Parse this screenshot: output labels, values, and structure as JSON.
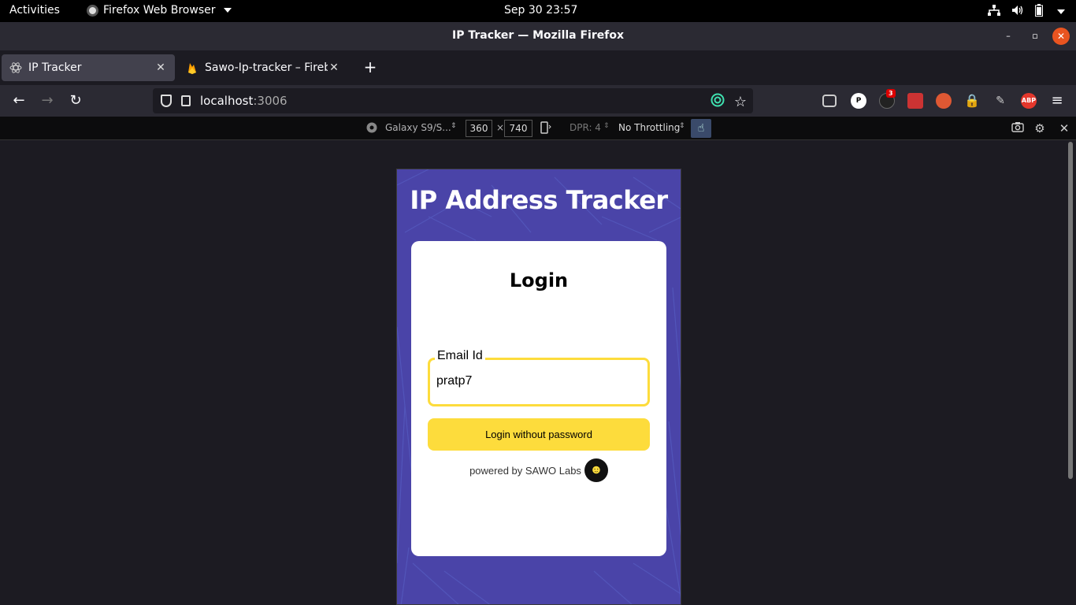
{
  "os": {
    "activities": "Activities",
    "app_name": "Firefox Web Browser",
    "clock": "Sep 30  23:57"
  },
  "window": {
    "title": "IP Tracker — Mozilla Firefox"
  },
  "tabs": [
    {
      "label": "IP Tracker",
      "active": true
    },
    {
      "label": "Sawo-Ip-tracker – Firebas",
      "active": false
    }
  ],
  "urlbar": {
    "host": "localhost",
    "port": ":3006"
  },
  "extensions": {
    "badge_count": "3",
    "abp": "ABP",
    "p": "P"
  },
  "devtools": {
    "device": "Galaxy S9/S...",
    "width": "360",
    "height": "740",
    "times": "×",
    "dpr": "DPR: 4",
    "throttling": "No Throttling"
  },
  "page": {
    "heading": "IP Address Tracker",
    "card_title": "Login",
    "email_label": "Email Id",
    "email_value": "pratp7",
    "login_button": "Login without password",
    "powered_by": "powered by SAWO Labs"
  },
  "colors": {
    "accent_yellow": "#fddc3c",
    "page_bg": "#4a44a8",
    "ubuntu_close": "#e95420"
  }
}
